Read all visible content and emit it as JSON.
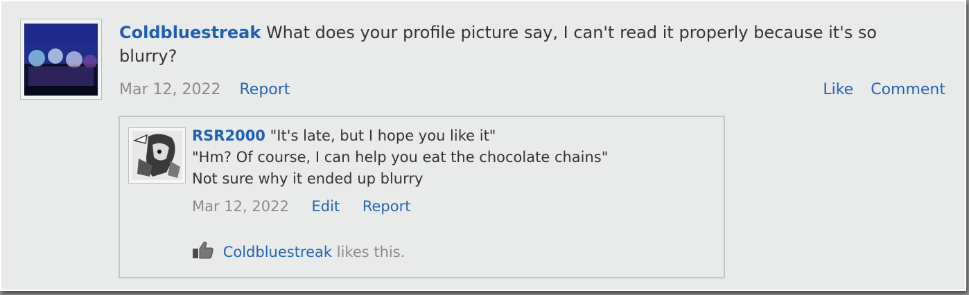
{
  "post": {
    "author": "Coldbluestreak",
    "text": "What does your profile picture say, I can't read it properly because it's so blurry?",
    "date": "Mar 12, 2022",
    "report_label": "Report",
    "like_label": "Like",
    "comment_label": "Comment"
  },
  "reply": {
    "author": "RSR2000",
    "line1": "\"It's late, but I hope you like it\"",
    "line2": "\"Hm? Of course, I can help you eat the chocolate chains\"",
    "line3": "Not sure why it ended up blurry",
    "date": "Mar 12, 2022",
    "edit_label": "Edit",
    "report_label": "Report",
    "likes": {
      "icon": "thumbs-up-icon",
      "liker": "Coldbluestreak",
      "suffix": "likes this."
    }
  },
  "colors": {
    "link": "#2463b8",
    "username": "#1f5fb4",
    "muted": "#8a8a8a",
    "background": "#e9ebea"
  }
}
